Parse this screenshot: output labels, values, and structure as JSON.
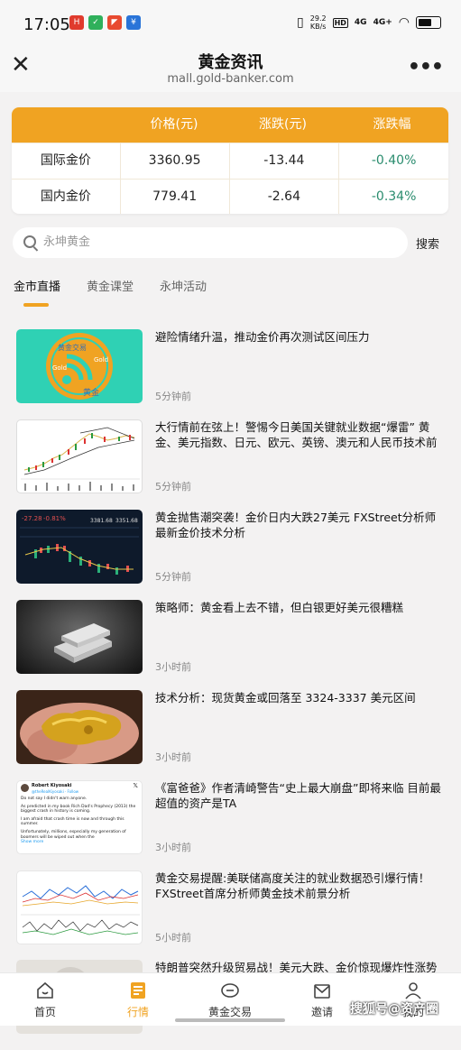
{
  "status_bar": {
    "time": "17:05",
    "apps": [
      {
        "name": "app-news",
        "color": "#e03b2d",
        "glyph": "H"
      },
      {
        "name": "app-shield",
        "color": "#2fb05b",
        "glyph": "✓"
      },
      {
        "name": "app-red",
        "color": "#e84a30",
        "glyph": "◤"
      },
      {
        "name": "app-blue",
        "color": "#2a74d8",
        "glyph": "¥"
      }
    ],
    "net_speed": "29.2\nKB/s",
    "hd": "HD",
    "sig1": "4G",
    "sig2": "4G+"
  },
  "title_bar": {
    "title": "黄金资讯",
    "subtitle": "mall.gold-banker.com"
  },
  "price_table": {
    "headers": [
      "",
      "价格(元)",
      "涨跌(元)",
      "涨跌幅"
    ],
    "rows": [
      {
        "name": "国际金价",
        "price": "3360.95",
        "change": "-13.44",
        "pct": "-0.40%"
      },
      {
        "name": "国内金价",
        "price": "779.41",
        "change": "-2.64",
        "pct": "-0.34%"
      }
    ],
    "accent_color": "#f0a322",
    "down_color": "#2a8c6e"
  },
  "search": {
    "placeholder": "永坤黄金",
    "button_label": "搜索"
  },
  "tabs": [
    {
      "label": "金市直播",
      "active": true
    },
    {
      "label": "黄金课堂",
      "active": false
    },
    {
      "label": "永坤活动",
      "active": false
    }
  ],
  "news": [
    {
      "title": "避险情绪升温，推动金价再次测试区间压力",
      "time": "5分钟前",
      "thumb": "rss-gold"
    },
    {
      "title": "大行情前在弦上！警惕今日美国关键就业数据“爆雷” 黄金、美元指数、日元、欧元、英镑、澳元和人民币技术前景",
      "time": "5分钟前",
      "thumb": "candle-chart"
    },
    {
      "title": "黄金抛售潮突袭！金价日内大跌27美元 FXStreet分析师最新金价技术分析",
      "time": "5分钟前",
      "thumb": "dark-chart"
    },
    {
      "title": "策略师：黄金看上去不错，但白银更好美元很糟糕",
      "time": "3小时前",
      "thumb": "silver-bars"
    },
    {
      "title": "技术分析：现货黄金或回落至 3324-3337 美元区间",
      "time": "3小时前",
      "thumb": "gold-nugget"
    },
    {
      "title": "《富爸爸》作者清崎警告“史上最大崩盘”即将来临 目前最超值的资产是TA",
      "time": "3小时前",
      "thumb": "tweet"
    },
    {
      "title": "黄金交易提醒:美联储高度关注的就业数据恐引爆行情！FXStreet首席分析师黄金技术前景分析",
      "time": "5小时前",
      "thumb": "line-chart"
    },
    {
      "title": "特朗普突然升级贸易战！美元大跌、金价惊现爆炸性涨势 大",
      "time": "",
      "thumb": "partial"
    }
  ],
  "thumb_text": {
    "tweet_name": "Robert Kiyosaki",
    "tweet_handle": "@theRealKiyosaki · Follow",
    "tweet_lines": [
      "Do not say I didn't warn anyone.",
      "As predicted in my book Rich Dad's Prophecy (2013) the biggest crash in history is coming.",
      "I am afraid that crash time is now and through this summer.",
      "Unfortunately, millions, especially my generation of boomers will be wiped out when the"
    ],
    "tweet_more": "Show more",
    "dark_chart_nums": [
      "-27.28",
      "-0.81%",
      "3381.68",
      "3351.68"
    ],
    "rss_words": [
      "黄金交易",
      "Gold",
      "黄金",
      "Gold"
    ]
  },
  "bottom_nav": [
    {
      "label": "首页",
      "icon": "home-icon",
      "active": false
    },
    {
      "label": "行情",
      "icon": "chart-icon",
      "active": true
    },
    {
      "label": "黄金交易",
      "icon": "gold-bar-icon",
      "active": false
    },
    {
      "label": "邀请",
      "icon": "mail-icon",
      "active": false
    },
    {
      "label": "我的",
      "icon": "user-icon",
      "active": false
    }
  ],
  "watermark": "搜狐号@资产圈"
}
